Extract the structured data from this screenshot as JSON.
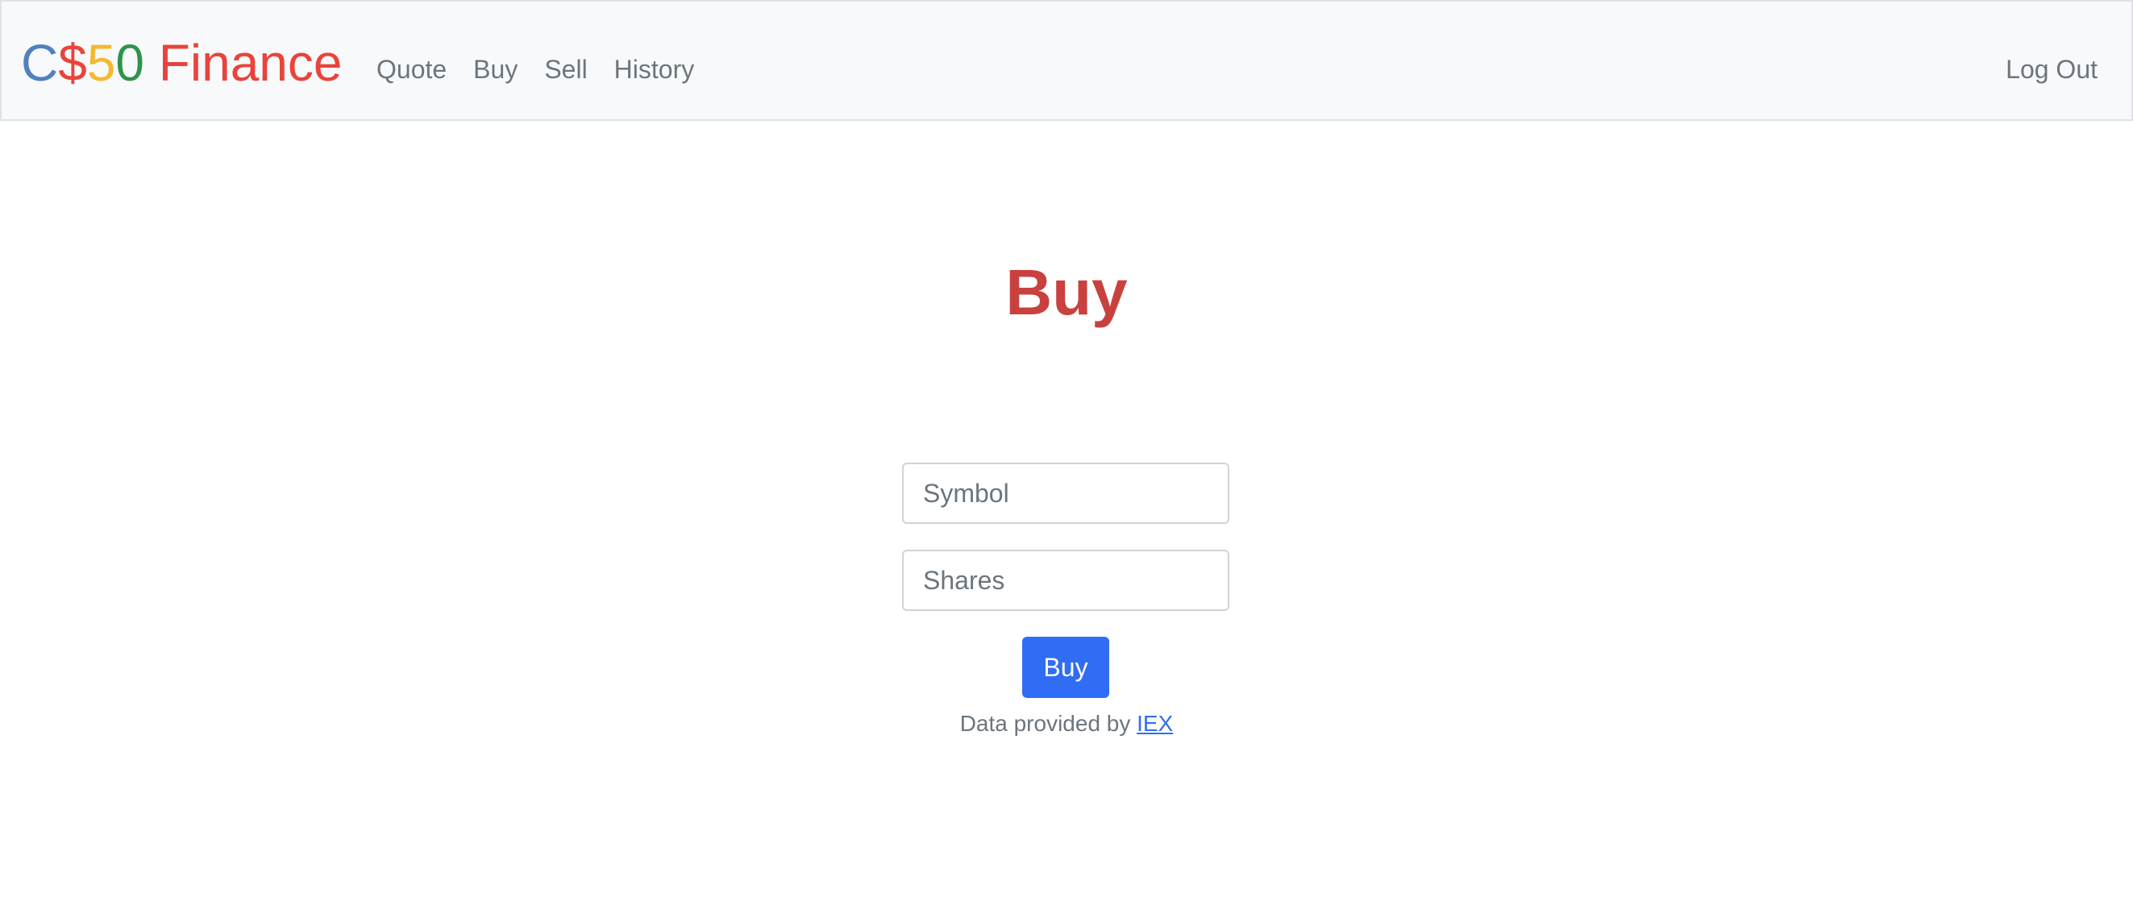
{
  "navbar": {
    "brand": [
      {
        "text": "C",
        "color": "#537fbe"
      },
      {
        "text": "$",
        "color": "#ea433b"
      },
      {
        "text": "5",
        "color": "#f5b82e"
      },
      {
        "text": "0",
        "color": "#2e944b"
      },
      {
        "text": " Finance",
        "color": "#ea433b"
      }
    ],
    "links": {
      "quote": "Quote",
      "buy": "Buy",
      "sell": "Sell",
      "history": "History"
    },
    "logout": "Log Out"
  },
  "main": {
    "heading": "Buy",
    "symbol_placeholder": "Symbol",
    "shares_placeholder": "Shares",
    "submit_label": "Buy"
  },
  "footer": {
    "prefix": "Data provided by ",
    "link_text": "IEX"
  },
  "colors": {
    "heading": "#c9413f",
    "primary_button": "#316cf4",
    "navbar_bg": "#f8f9fa",
    "muted_text": "#6c757d",
    "link": "#2f6ff4"
  }
}
